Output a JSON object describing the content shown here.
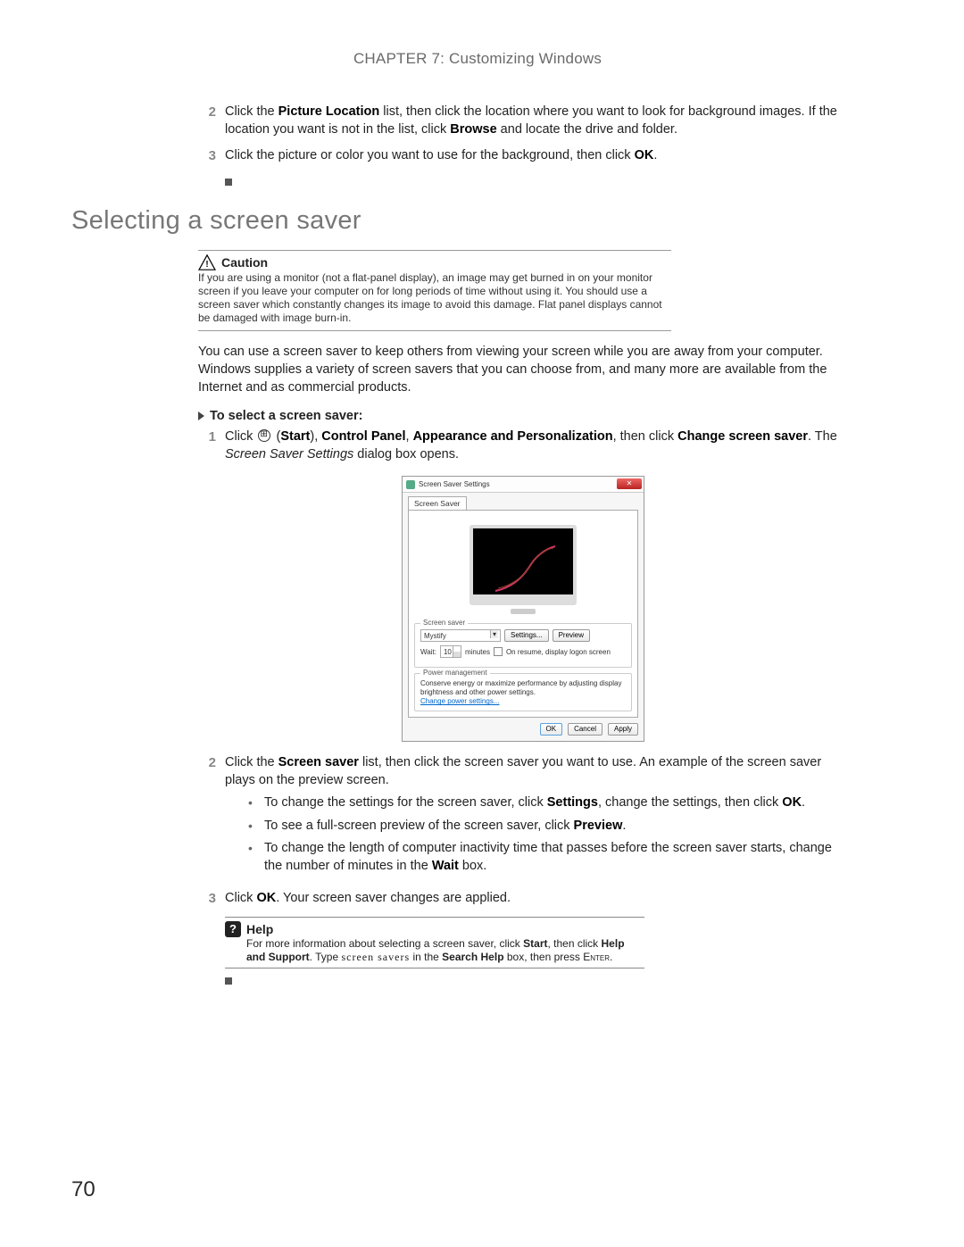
{
  "chapter_header": "CHAPTER 7: Customizing Windows",
  "steps_a": {
    "s2_num": "2",
    "s2_pre": "Click the ",
    "s2_b1": "Picture Location",
    "s2_mid": " list, then click the location where you want to look for background images. If the location you want is not in the list, click ",
    "s2_b2": "Browse",
    "s2_post": " and locate the drive and folder.",
    "s3_num": "3",
    "s3_pre": "Click the picture or color you want to use for the background, then click ",
    "s3_b1": "OK",
    "s3_post": "."
  },
  "section_title": "Selecting a screen saver",
  "caution": {
    "label": "Caution",
    "text": "If you are using a monitor (not a flat-panel display), an image may get burned in on your monitor screen if you leave your computer on for long periods of time without using it. You should use a screen saver which constantly changes its image to avoid this damage. Flat panel displays cannot be damaged with image burn-in."
  },
  "intro_para": "You can use a screen saver to keep others from viewing your screen while you are away from your computer. Windows supplies a variety of screen savers that you can choose from, and many more are available from the Internet and as commercial products.",
  "proc_header": "To select a screen saver:",
  "proc": {
    "s1_num": "1",
    "s1_pre": "Click ",
    "s1_paren_open": " (",
    "s1_b_start": "Start",
    "s1_sep1": "), ",
    "s1_b_cp": "Control Panel",
    "s1_sep2": ", ",
    "s1_b_ap": "Appearance and Personalization",
    "s1_sep3": ", then click ",
    "s1_b_cs": "Change screen saver",
    "s1_post_a": ". The ",
    "s1_ital": "Screen Saver Settings",
    "s1_post_b": " dialog box opens.",
    "s2_num": "2",
    "s2_pre": "Click the ",
    "s2_b1": "Screen saver",
    "s2_post": " list, then click the screen saver you want to use. An example of the screen saver plays on the preview screen.",
    "s3_num": "3",
    "s3_pre": "Click ",
    "s3_b1": "OK",
    "s3_post": ". Your screen saver changes are applied."
  },
  "bullets": {
    "a_pre": "To change the settings for the screen saver, click ",
    "a_b": "Settings",
    "a_mid": ", change the settings, then click ",
    "a_b2": "OK",
    "a_post": ".",
    "b_pre": "To see a full-screen preview of the screen saver, click ",
    "b_b": "Preview",
    "b_post": ".",
    "c_pre": "To change the length of computer inactivity time that passes before the screen saver starts, change the number of minutes in the ",
    "c_b": "Wait",
    "c_post": " box."
  },
  "dialog": {
    "title": "Screen Saver Settings",
    "tab": "Screen Saver",
    "legend_ss": "Screen saver",
    "selected": "Mystify",
    "btn_settings": "Settings...",
    "btn_preview": "Preview",
    "wait_label": "Wait:",
    "wait_value": "10",
    "minutes_label": "minutes",
    "resume_label": "On resume, display logon screen",
    "legend_pm": "Power management",
    "pm_text": "Conserve energy or maximize performance by adjusting display brightness and other power settings.",
    "pm_link": "Change power settings...",
    "btn_ok": "OK",
    "btn_cancel": "Cancel",
    "btn_apply": "Apply"
  },
  "help": {
    "label": "Help",
    "t1": "For more information about selecting a screen saver, click ",
    "b1": "Start",
    "t2": ", then click ",
    "b2": "Help and Support",
    "t3": ". Type ",
    "kw": "screen savers",
    "t4": " in the ",
    "b3": "Search Help",
    "t5": " box, then press ",
    "enter": "Enter",
    "t6": "."
  },
  "page_number": "70"
}
